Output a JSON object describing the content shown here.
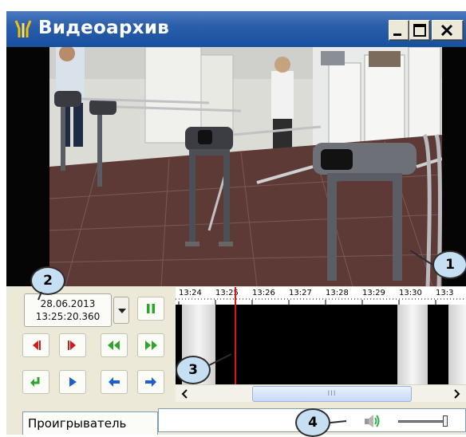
{
  "window": {
    "title": "Видеоархив",
    "icon": "turnstile-logo-icon"
  },
  "date_picker": {
    "date": "28.06.2013",
    "time": "13:25:20.360"
  },
  "controls": {
    "pause": "pause-icon",
    "rows": [
      [
        "prev-frame-icon",
        "next-frame-icon",
        "rewind-icon",
        "fast-forward-icon"
      ],
      [
        "go-to-start-icon",
        "play-forward-icon",
        "previous-event-icon",
        "next-event-icon"
      ]
    ]
  },
  "timeline": {
    "ticks": [
      "13:24",
      "13:25",
      "13:26",
      "13:27",
      "13:28",
      "13:29",
      "13:30",
      "13:3"
    ],
    "scroll_thumb_label": "III"
  },
  "tabs": {
    "player": "Проигрыватель"
  },
  "callouts": {
    "c1": "1",
    "c2": "2",
    "c3": "3",
    "c4": "4"
  }
}
